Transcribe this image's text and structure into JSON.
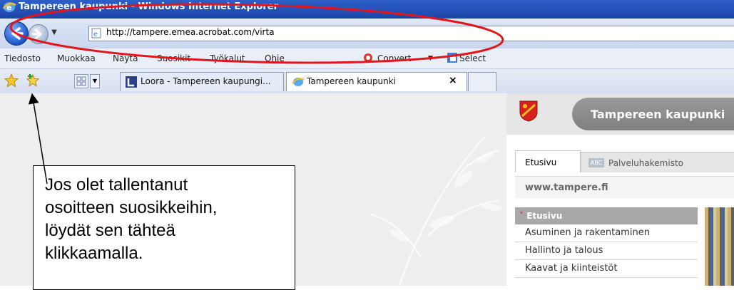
{
  "window": {
    "title": "Tampereen kaupunki - Windows Internet Explorer"
  },
  "address_bar": {
    "url": "http://tampere.emea.acrobat.com/virta"
  },
  "menu": {
    "items": [
      "Tiedosto",
      "Muokkaa",
      "Näytä",
      "Suosikit",
      "Työkalut",
      "Ohje"
    ],
    "convert_label": "Convert",
    "select_label": "Select"
  },
  "tabs": [
    {
      "label": "Loora - Tampereen kaupungi..."
    },
    {
      "label": "Tampereen kaupunki",
      "close": "×"
    }
  ],
  "site": {
    "title": "Tampereen kaupunki",
    "tabs": [
      "Etusivu",
      "Palveluhakemisto"
    ],
    "abc_label": "ABC",
    "url_text": "www.tampere.fi",
    "nav_header": "Etusivu",
    "nav_items": [
      "Asuminen ja rakentaminen",
      "Hallinto ja talous",
      "Kaavat ja kiinteistöt"
    ]
  },
  "annotation": {
    "text": "Jos olet tallentanut\nosoitteen suosikkeihin,\nlöydät sen tähteä\nklikkaamalla."
  },
  "colors": {
    "highlight_ellipse": "#e0161b",
    "titlebar": "#1c46a8",
    "site_nav_header": "#a8a8a8"
  },
  "icons": {
    "favorites": "star-icon",
    "add_favorite": "add-favorite-icon",
    "back": "back-arrow-icon",
    "forward": "forward-arrow-icon"
  }
}
